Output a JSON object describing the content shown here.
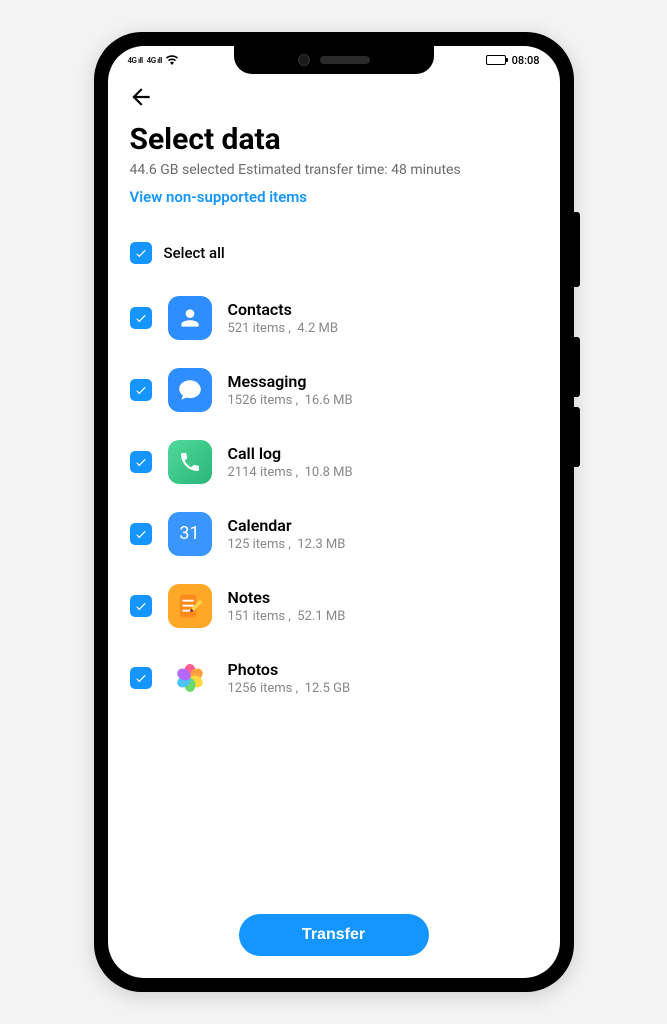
{
  "status": {
    "signal1": "4G ıll",
    "signal2": "4G ıll",
    "time": "08:08"
  },
  "header": {
    "title": "Select data",
    "subtitle": "44.6 GB selected Estimated transfer time: 48 minutes",
    "link": "View non-supported items"
  },
  "selectAll": {
    "label": "Select all",
    "checked": true
  },
  "items": [
    {
      "icon": "contacts",
      "title": "Contacts",
      "count": "521 items",
      "size": "4.2 MB",
      "checked": true
    },
    {
      "icon": "messaging",
      "title": "Messaging",
      "count": "1526 items",
      "size": "16.6 MB",
      "checked": true
    },
    {
      "icon": "calllog",
      "title": "Call log",
      "count": "2114 items",
      "size": "10.8 MB",
      "checked": true
    },
    {
      "icon": "calendar",
      "title": "Calendar",
      "count": "125 items",
      "size": "12.3 MB",
      "checked": true
    },
    {
      "icon": "notes",
      "title": "Notes",
      "count": "151 items",
      "size": "52.1 MB",
      "checked": true
    },
    {
      "icon": "photos",
      "title": "Photos",
      "count": "1256 items",
      "size": "12.5 GB",
      "checked": true
    }
  ],
  "button": {
    "label": "Transfer"
  },
  "calendarDay": "31"
}
